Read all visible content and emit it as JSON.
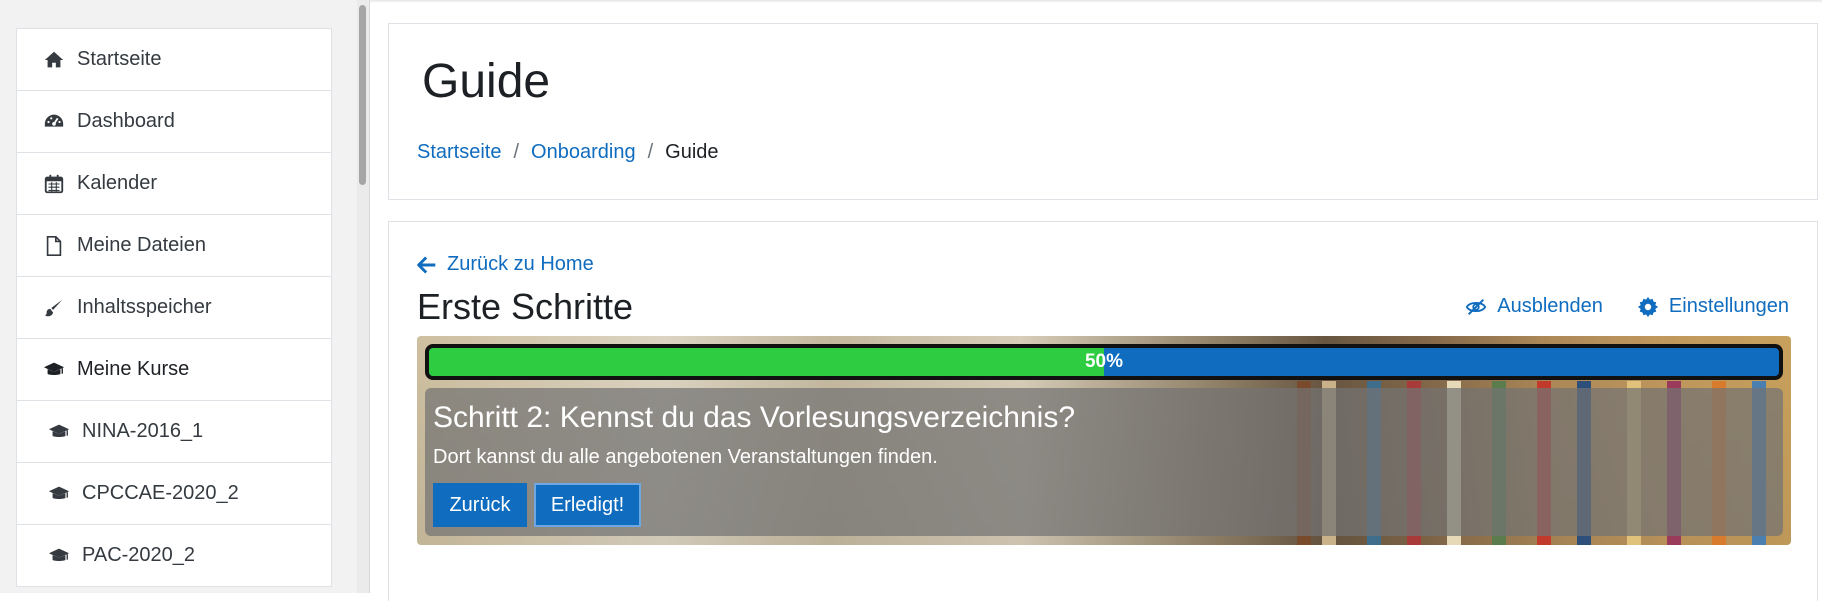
{
  "sidebar": {
    "items": [
      {
        "label": "Startseite",
        "icon": "home-icon"
      },
      {
        "label": "Dashboard",
        "icon": "dashboard-icon"
      },
      {
        "label": "Kalender",
        "icon": "calendar-icon"
      },
      {
        "label": "Meine Dateien",
        "icon": "file-icon"
      },
      {
        "label": "Inhaltsspeicher",
        "icon": "brush-icon"
      },
      {
        "label": "Meine Kurse",
        "icon": "graduation-cap-icon"
      },
      {
        "label": "NINA-2016_1",
        "icon": "graduation-cap-icon"
      },
      {
        "label": "CPCCAE-2020_2",
        "icon": "graduation-cap-icon"
      },
      {
        "label": "PAC-2020_2",
        "icon": "graduation-cap-icon"
      }
    ]
  },
  "header": {
    "title": "Guide",
    "breadcrumb": [
      "Startseite",
      "Onboarding",
      "Guide"
    ],
    "separator": "/"
  },
  "main": {
    "back_link": "Zurück zu Home",
    "section_title": "Erste Schritte",
    "actions": {
      "hide_label": "Ausblenden",
      "settings_label": "Einstellungen"
    },
    "progress": {
      "value": 0.5,
      "label": "50%"
    },
    "step": {
      "title": "Schritt 2: Kennst du das Vorlesungsverzeichnis?",
      "description": "Dort kannst du alle angebotenen Veranstaltungen finden.",
      "back_button": "Zurück",
      "done_button": "Erledigt!"
    }
  },
  "colors": {
    "link": "#0f6cbf",
    "progress_fill": "#2ecc40",
    "progress_track": "#0f6cbf",
    "button": "#0f6cbf"
  }
}
